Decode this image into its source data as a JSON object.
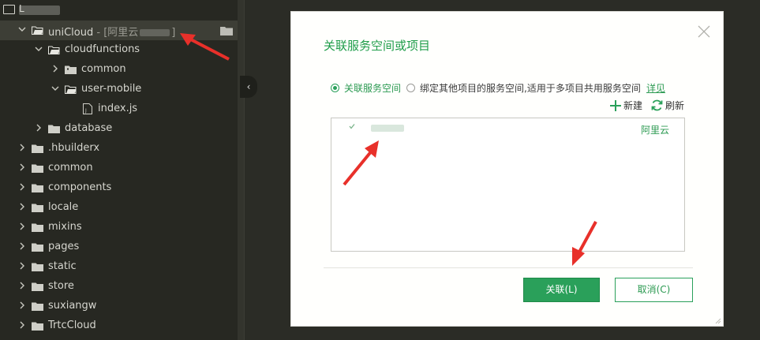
{
  "tree": {
    "root_label": "L",
    "items": [
      {
        "label": "uniCloud",
        "suffix": "- [阿里云",
        "suffix_end": "]",
        "caret": "v"
      },
      {
        "label": "cloudfunctions",
        "caret": "v"
      },
      {
        "label": "common",
        "caret": ">"
      },
      {
        "label": "user-mobile",
        "caret": "v"
      },
      {
        "label": "index.js",
        "caret": ""
      },
      {
        "label": "database",
        "caret": ">"
      },
      {
        "label": ".hbuilderx",
        "caret": ">"
      },
      {
        "label": "common",
        "caret": ">"
      },
      {
        "label": "components",
        "caret": ">"
      },
      {
        "label": "locale",
        "caret": ">"
      },
      {
        "label": "mixins",
        "caret": ">"
      },
      {
        "label": "pages",
        "caret": ">"
      },
      {
        "label": "static",
        "caret": ">"
      },
      {
        "label": "store",
        "caret": ">"
      },
      {
        "label": "suxiangw",
        "caret": ">"
      },
      {
        "label": "TrtcCloud",
        "caret": ">"
      }
    ]
  },
  "editor": {
    "collapse_glyph": "‹"
  },
  "dialog": {
    "title": "关联服务空间或项目",
    "radio_option_1": "关联服务空间",
    "radio_option_2": "绑定其他项目的服务空间,适用于多项目共用服务空间",
    "detail_link": "详见",
    "new_label": "新建",
    "refresh_label": "刷新",
    "list_items": [
      {
        "provider": "阿里云"
      }
    ],
    "ok_button": "关联(L)",
    "cancel_button": "取消(C)"
  },
  "colors": {
    "accent_green": "#2aa05a",
    "annotation_red": "#e8302a"
  }
}
